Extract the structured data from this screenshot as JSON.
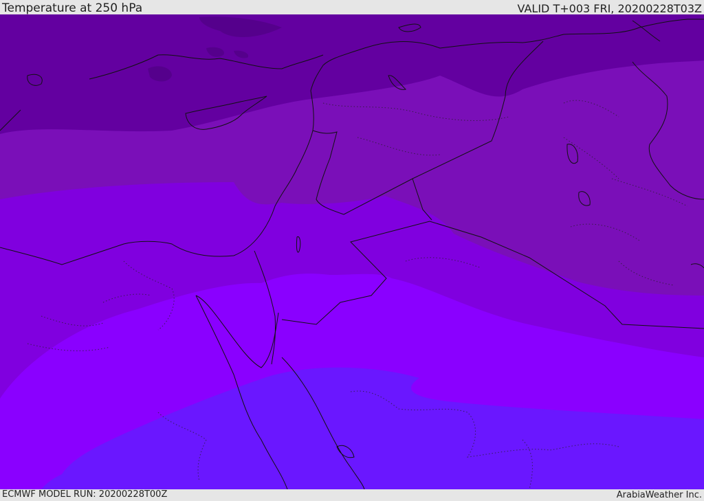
{
  "header": {
    "title": "Temperature at 250 hPa",
    "valid": "VALID T+003 FRI, 20200228T03Z"
  },
  "footer": {
    "model_run": "ECMWF MODEL RUN: 20200228T00Z",
    "credit": "ArabiaWeather Inc."
  },
  "colors": {
    "band_1": "#6300a0",
    "band_2": "#7a0fb8",
    "band_3": "#8000df",
    "band_4": "#8a00ff",
    "band_5": "#6a17ff",
    "coastline": "#111111",
    "border": "#111111",
    "header_bg": "#e6e6e6"
  }
}
